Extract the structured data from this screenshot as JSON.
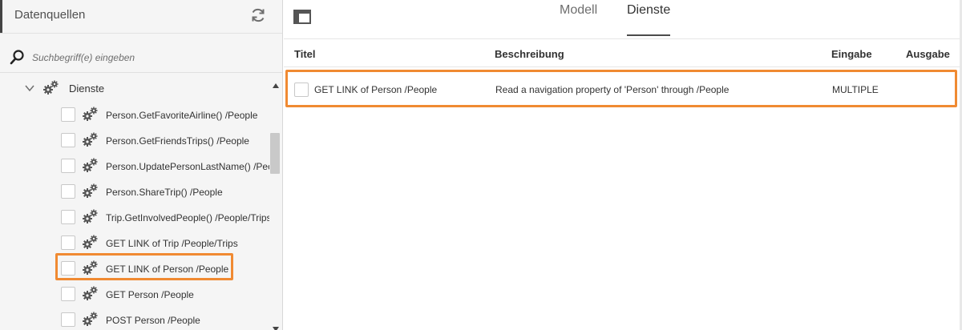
{
  "left_panel": {
    "title": "Datenquellen",
    "refresh_icon": "refresh-icon",
    "search": {
      "icon": "search-icon",
      "placeholder": "Suchbegriff(e) eingeben",
      "value": ""
    },
    "tree": {
      "parent": {
        "label": "Dienste",
        "icon": "gear-icon",
        "expanded": true
      },
      "items": [
        {
          "label": "Person.GetFavoriteAirline() /People",
          "checked": false
        },
        {
          "label": "Person.GetFriendsTrips() /People",
          "checked": false
        },
        {
          "label": "Person.UpdatePersonLastName() /People",
          "checked": false
        },
        {
          "label": "Person.ShareTrip() /People",
          "checked": false
        },
        {
          "label": "Trip.GetInvolvedPeople() /People/Trips",
          "checked": false
        },
        {
          "label": "GET LINK of Trip /People/Trips",
          "checked": false
        },
        {
          "label": "GET LINK of Person /People",
          "checked": false,
          "highlighted": true
        },
        {
          "label": "GET Person /People",
          "checked": false
        },
        {
          "label": "POST Person /People",
          "checked": false
        }
      ]
    }
  },
  "right_panel": {
    "tabs": [
      {
        "label": "Modell",
        "active": false
      },
      {
        "label": "Dienste",
        "active": true
      }
    ],
    "table": {
      "columns": [
        "Titel",
        "Beschreibung",
        "Eingabe",
        "Ausgabe"
      ],
      "rows": [
        {
          "title": "GET LINK of Person /People",
          "description": "Read a navigation property of 'Person' through /People",
          "input": "MULTIPLE",
          "output": "",
          "highlighted": true
        }
      ]
    }
  },
  "colors": {
    "highlight": "#f08a32",
    "sidebar_bg": "#f5f5f5",
    "text": "#323232"
  }
}
